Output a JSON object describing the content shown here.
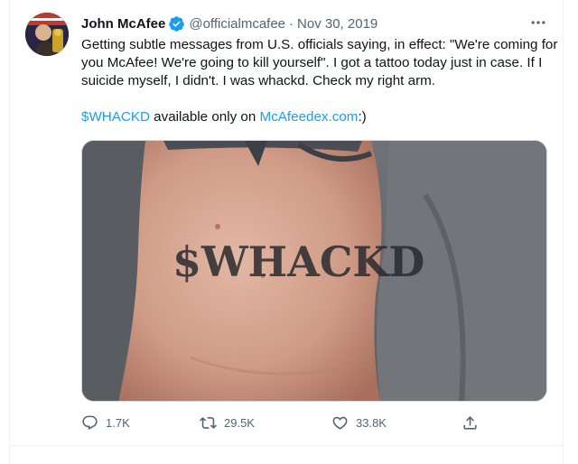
{
  "tweet": {
    "author_name": "John McAfee",
    "handle": "@officialmcafee",
    "separator": "·",
    "date": "Nov 30, 2019",
    "text": "Getting subtle messages from U.S. officials saying, in effect: \"We're coming for you McAfee! We're going to kill yourself\". I got a tattoo today just in case. If I suicide myself, I didn't. I was whackd. Check my right arm.",
    "cashtag": "$WHACKD",
    "link_middle": " available only on ",
    "link": "McAfeedex.com",
    "link_suffix": ":)",
    "media": {
      "tattoo_text": "$WHACKD"
    },
    "stats": {
      "replies": "1.7K",
      "retweets": "29.5K",
      "likes": "33.8K"
    }
  },
  "colors": {
    "accent": "#1d9bf0",
    "secondary_text": "#536471",
    "primary_text": "#0f1419"
  },
  "icons": {
    "verified": "verified-badge-icon",
    "more": "more-dots-icon",
    "reply": "reply-bubble-icon",
    "retweet": "retweet-arrows-icon",
    "like": "heart-icon",
    "share": "share-upload-icon"
  }
}
